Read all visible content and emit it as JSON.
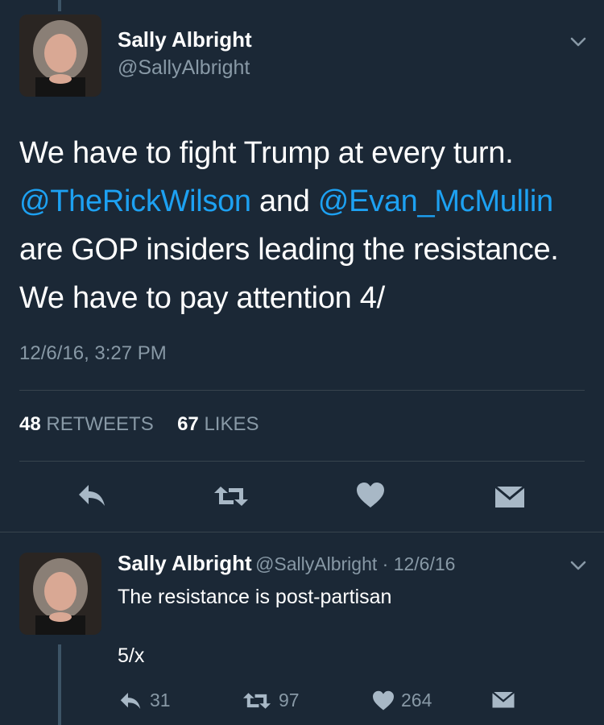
{
  "main_tweet": {
    "author_name": "Sally Albright",
    "author_handle": "@SallyAlbright",
    "text_parts": {
      "line1": "We have to fight Trump at every turn.",
      "mention1": "@TheRickWilson",
      "and": " and ",
      "mention2": "@Evan_McMullin",
      "rest": " are GOP insiders leading the resistance. We have to pay attention 4/"
    },
    "timestamp": "12/6/16, 3:27 PM",
    "retweets_count": "48",
    "retweets_label": "RETWEETS",
    "likes_count": "67",
    "likes_label": "LIKES",
    "actions": [
      "reply-icon",
      "retweet-icon",
      "heart-icon",
      "envelope-icon"
    ]
  },
  "reply_tweet": {
    "author_name": "Sally Albright",
    "meta": "@SallyAlbright · 12/6/16",
    "text_line1": "The resistance is post-partisan",
    "text_line2": "5/x",
    "reply_count": "31",
    "retweet_count": "97",
    "like_count": "264"
  },
  "colors": {
    "background": "#1b2836",
    "mention": "#1da1f2",
    "muted": "#8899a6",
    "icon": "#a8b8c6"
  }
}
